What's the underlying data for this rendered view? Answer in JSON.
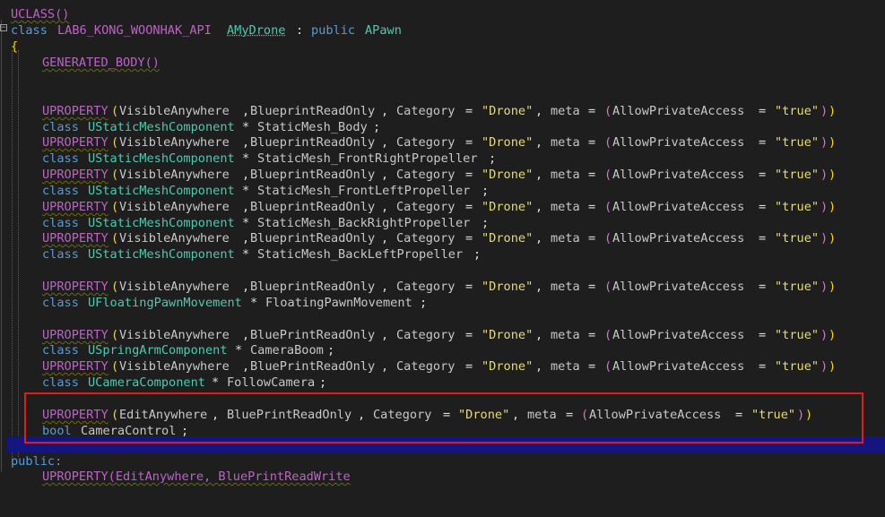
{
  "editor": {
    "line_uclass": "UCLASS()",
    "class_kw": "class",
    "api_macro": "LAB6_KONG_WOONHAK_API",
    "class_name": "AMyDrone",
    "colon": ":",
    "public_kw": "public",
    "base_class": "APawn",
    "open_brace": "{",
    "generated_body": "GENERATED_BODY()",
    "uprop": "UPROPERTY",
    "visible_anywhere": "VisibleAnywhere",
    "edit_anywhere": "EditAnywhere",
    "blueprint_read_only_a": "BlueprintReadOnly",
    "blueprint_read_only_b": "BluePrintReadOnly",
    "category": "Category",
    "drone_str": "\"Drone\"",
    "meta": "meta",
    "allow_private": "AllowPrivateAccess",
    "true_str": "\"true\"",
    "static_mesh_component": "UStaticMeshComponent",
    "floating_pawn_movement": "UFloatingPawnMovement",
    "spring_arm_component": "USpringArmComponent",
    "camera_component": "UCameraComponent",
    "bool_kw": "bool",
    "members": {
      "body": "StaticMesh_Body",
      "front_right": "StaticMesh_FrontRightPropeller",
      "front_left": "StaticMesh_FrontLeftPropeller",
      "back_right": "StaticMesh_BackRightPropeller",
      "back_left": "StaticMesh_BackLeftPropeller",
      "floating": "FloatingPawnMovement",
      "camera_boom": "CameraBoom",
      "follow_camera": "FollowCamera",
      "camera_control": "CameraControl"
    },
    "public_label": "public:",
    "last_line_partial": "UPROPERTY(EditAnywhere, BluePrintReadWrite"
  }
}
